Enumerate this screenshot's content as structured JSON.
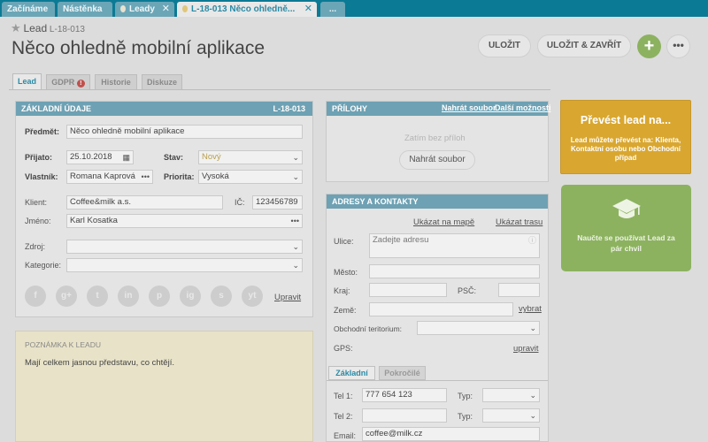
{
  "top_tabs": [
    {
      "label": "Začínáme"
    },
    {
      "label": "Nástěnka"
    },
    {
      "label": "Leady"
    },
    {
      "label": "L-18-013 Něco ohledně..."
    },
    {
      "label": "..."
    }
  ],
  "header": {
    "type_label": "Lead",
    "record_id": "L-18-013",
    "title": "Něco ohledně mobilní aplikace",
    "save_label": "ULOŽIT",
    "save_close_label": "ULOŽIT & ZAVŘÍT"
  },
  "sub_tabs": [
    {
      "label": "Lead"
    },
    {
      "label": "GDPR"
    },
    {
      "label": "Historie"
    },
    {
      "label": "Diskuze"
    }
  ],
  "basic": {
    "title": "ZÁKLADNÍ ÚDAJE",
    "id": "L-18-013",
    "subject_label": "Předmět:",
    "subject_value": "Něco ohledně mobilní aplikace",
    "received_label": "Přijato:",
    "received_value": "25.10.2018",
    "state_label": "Stav:",
    "state_value": "Nový",
    "owner_label": "Vlastník:",
    "owner_value": "Romana Kaprová",
    "priority_label": "Priorita:",
    "priority_value": "Vysoká",
    "client_label": "Klient:",
    "client_value": "Coffee&milk a.s.",
    "ic_label": "IČ:",
    "ic_value": "123456789",
    "name_label": "Jméno:",
    "name_value": "Karl Kosatka",
    "source_label": "Zdroj:",
    "category_label": "Kategorie:",
    "edit_link": "Upravit"
  },
  "social_icons": [
    "f",
    "g+",
    "t",
    "in",
    "p",
    "ig",
    "s",
    "yt"
  ],
  "note": {
    "title": "POZNÁMKA K LEADU",
    "text": "Mají celkem jasnou představu, co chtějí."
  },
  "attachments": {
    "title": "PŘÍLOHY",
    "upload_link": "Nahrát soubor",
    "more_link": "Další možnosti",
    "empty_text": "Zatím bez příloh",
    "upload_button": "Nahrát soubor"
  },
  "address": {
    "title": "ADRESY A KONTAKTY",
    "map_link": "Ukázat na mapě",
    "route_link": "Ukázat trasu",
    "street_label": "Ulice:",
    "street_placeholder": "Zadejte adresu",
    "city_label": "Město:",
    "region_label": "Kraj:",
    "zip_label": "PSČ:",
    "country_label": "Země:",
    "choose_link": "vybrat",
    "territory_label": "Obchodní teritorium:",
    "gps_label": "GPS:",
    "edit_link": "upravit",
    "tab_basic": "Základní",
    "tab_advanced": "Pokročilé",
    "tel1_label": "Tel 1:",
    "tel1_value": "777 654 123",
    "type_label": "Typ:",
    "tel2_label": "Tel 2:",
    "email_label": "Email:",
    "email_value": "coffee@milk.cz"
  },
  "convert": {
    "title": "Převést lead na...",
    "subtitle": "Lead můžete převést na: Klienta, Kontaktní osobu nebo Obchodní případ"
  },
  "learn": {
    "text": "Naučte se používat Lead za pár chvil"
  },
  "colors": {
    "convert_bg": "#d9a730",
    "learn_bg": "#8cb25f",
    "header_bar": "#6ea1b3",
    "accent": "#2a8aa5"
  }
}
